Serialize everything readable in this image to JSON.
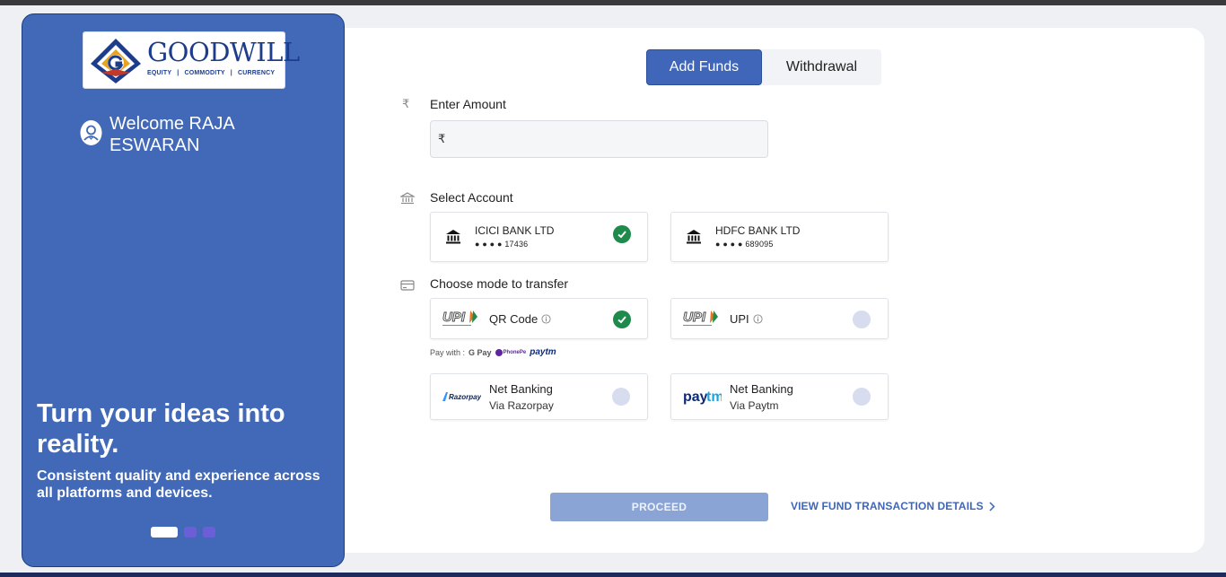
{
  "brand": {
    "name": "GOODWILL",
    "tagline": [
      "EQUITY",
      "COMMODITY",
      "CURRENCY"
    ],
    "separator": "|"
  },
  "sidebar": {
    "welcome": "Welcome RAJA ESWARAN",
    "headline": "Turn your ideas into reality.",
    "subline": "Consistent quality and experience across all platforms and devices.",
    "carousel_active": 1,
    "carousel_count": 3
  },
  "tabs": [
    {
      "label": "Add Funds",
      "active": true
    },
    {
      "label": "Withdrawal",
      "active": false
    }
  ],
  "amount": {
    "label": "Enter Amount",
    "currency_symbol": "₹",
    "value": "",
    "placeholder": ""
  },
  "account": {
    "label": "Select Account",
    "banks": [
      {
        "name": "ICICI BANK LTD",
        "masked": "● ● ● ● 17436",
        "selected": true
      },
      {
        "name": "HDFC BANK LTD",
        "masked": "● ● ● ● 689095",
        "selected": false
      }
    ]
  },
  "transfer": {
    "label": "Choose mode to transfer",
    "modes": [
      {
        "logo": "UPI",
        "title": "QR Code",
        "has_info": true,
        "selected": true
      },
      {
        "logo": "UPI",
        "title": "UPI",
        "has_info": true,
        "selected": false
      },
      {
        "logo": "Razorpay",
        "title": "Net Banking",
        "sub": "Via Razorpay",
        "selected": false
      },
      {
        "logo": "Paytm",
        "title": "Net Banking",
        "sub": "Via Paytm",
        "selected": false
      }
    ],
    "paywith_label": "Pay with :",
    "paywith_apps": [
      "G Pay",
      "PhonePe",
      "paytm"
    ]
  },
  "actions": {
    "proceed": "PROCEED",
    "view_details": "VIEW FUND TRANSACTION DETAILS"
  },
  "colors": {
    "primary": "#3f66b8",
    "panel": "#4169b8",
    "success": "#1e8a4c",
    "proceed_disabled": "#8aa4d6"
  },
  "icons": {
    "rupee": "rupee-icon",
    "bank": "bank-icon",
    "card": "card-icon",
    "check": "check-icon",
    "info": "info-icon",
    "chevron": "chevron-right-icon",
    "avatar": "user-avatar-icon"
  }
}
